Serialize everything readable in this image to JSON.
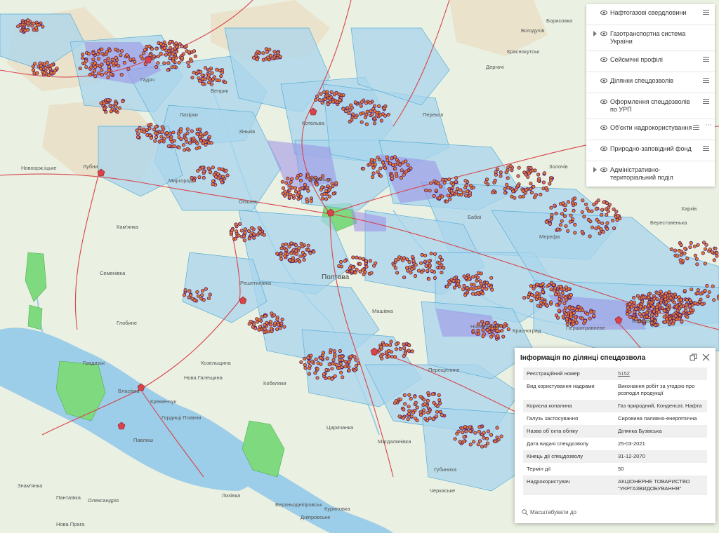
{
  "colors": {
    "land": "#eaf0e2",
    "permit_area": "#a9d6ec",
    "permit_stroke": "#5aaed6",
    "well_fill": "#e87b2a",
    "well_stroke": "#4a1a6e",
    "road": "#d9434b",
    "river": "#9ccde9",
    "reserve": "#7fd97f",
    "field": "#e9dcc0"
  },
  "map": {
    "places": [
      "Новоорж.іцьке",
      "Лубни",
      "Семенівка",
      "Глобине",
      "Градизьк",
      "Власівка",
      "Нова Галещина",
      "Козельщина",
      "Кобеляки",
      "Гордищі Плавни",
      "Павлиш",
      "Знам'янка",
      "Пантаївка",
      "Олександрія",
      "Нова Прага",
      "Лихівка",
      "Верхньодніпровськ",
      "Дніпровське",
      "Куриловка",
      "Царичанка",
      "Магдалинівка",
      "Губиниха",
      "Перещепине",
      "Черкаське",
      "Машівка",
      "Решетилівка",
      "Першотравневе",
      "Красноград",
      "Новоселівка",
      "Кегичівка",
      "Берестовенька",
      "Миргород",
      "Гадяч",
      "Зіньків",
      "Диканька",
      "Кременчук",
      "Котельва",
      "Полтава",
      "Харків",
      "Богодухів",
      "Краснокутськ",
      "Мерефа",
      "Веприк",
      "Борисовка",
      "Золочів",
      "Перекоп",
      "Дергачі",
      "Бабаї",
      "Кам'янка",
      "Лазірки",
      "Опішня"
    ]
  },
  "layer_panel": {
    "items": [
      {
        "label": "Нафтогазові свердловини"
      },
      {
        "label": "Газотранспортна система України"
      },
      {
        "label": "Сейсмічні профілі"
      },
      {
        "label": "Ділянки спецдозволів"
      },
      {
        "label": "Оформлення спецдозволів по УРП"
      },
      {
        "label": "Об'єкти надрокористування"
      },
      {
        "label": "Природно-заповідний фонд"
      },
      {
        "label": "Адміністративно-територіальний поділ"
      }
    ]
  },
  "popup": {
    "title": "Інформація по ділянці спецдозвола",
    "rows": [
      {
        "key": "Реєстраційний номер",
        "value": "5152"
      },
      {
        "key": "Вид користування надрами",
        "value": "Виконання робіт за угодою про розподіл продукції"
      },
      {
        "key": "Корисна копалина",
        "value": "Газ природний, Конденсат, Нафта"
      },
      {
        "key": "Галузь застосування",
        "value": "Сировина паливно-енергетична"
      },
      {
        "key": "Назва об`єкта обліку",
        "value": "Ділянка Бузівська"
      },
      {
        "key": "Дата видачі спецдозволу",
        "value": "25-03-2021"
      },
      {
        "key": "Кінець дії спецдозволу",
        "value": "31-12-2070"
      },
      {
        "key": "Термін дії",
        "value": "50"
      },
      {
        "key": "Надрокористувач",
        "value": "АКЦІОНЕРНЕ ТОВАРИСТВО \"УКРГАЗВИДОБУВАННЯ\""
      }
    ],
    "zoom_label": "Масштабувати до"
  }
}
